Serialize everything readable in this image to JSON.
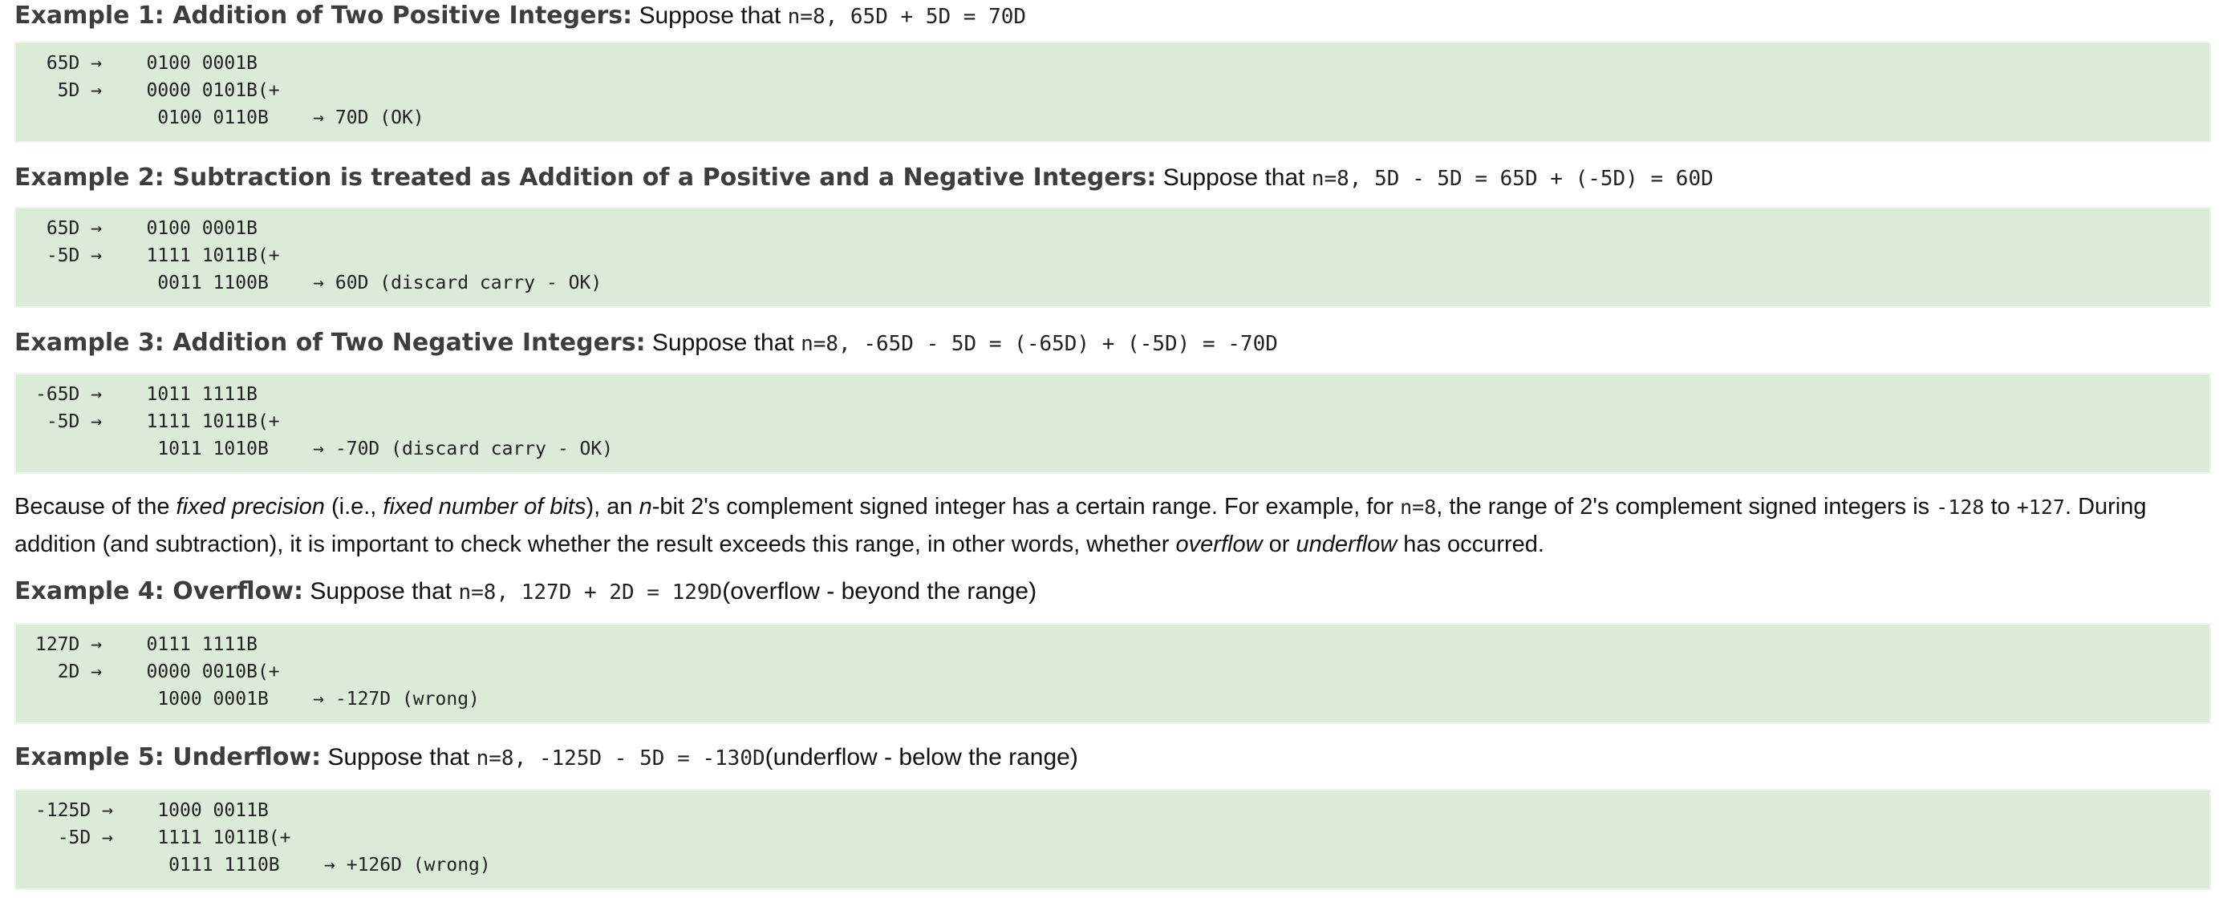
{
  "ex1": {
    "label": "Example 1: Addition of Two Positive Integers:",
    "lead": "Suppose that",
    "expr": "n=8, 65D + 5D = 70D",
    "code": " 65D →    0100 0001B\n  5D →    0000 0101B(+\n           0100 0110B    → 70D (OK)"
  },
  "ex2": {
    "label": "Example 2: Subtraction is treated as Addition of a Positive and a Negative Integers:",
    "lead": "Suppose that",
    "expr": "n=8, 5D - 5D = 65D + (-5D) = 60D",
    "code": " 65D →    0100 0001B\n -5D →    1111 1011B(+\n           0011 1100B    → 60D (discard carry - OK)"
  },
  "ex3": {
    "label": "Example 3: Addition of Two Negative Integers:",
    "lead": "Suppose that",
    "expr": "n=8, -65D - 5D = (-65D) + (-5D) = -70D",
    "code": "-65D →    1011 1111B\n -5D →    1111 1011B(+\n           1011 1010B    → -70D (discard carry - OK)"
  },
  "para": {
    "t1": "Because of the ",
    "i1": "fixed precision",
    "t2": " (i.e., ",
    "i2": "fixed number of bits",
    "t3": "), an ",
    "i3": "n",
    "t4": "-bit 2's complement signed integer has a certain range. For example, for ",
    "m1": "n=8",
    "t5": ", the range of 2's complement signed integers is ",
    "m2": "-128",
    "t6": " to ",
    "m3": "+127",
    "t7": ". During addition (and subtraction), it is important to check whether the result exceeds this range, in other words, whether ",
    "i4": "overflow",
    "t8": " or ",
    "i5": "underflow",
    "t9": " has occurred."
  },
  "ex4": {
    "label": "Example 4: Overflow:",
    "lead": "Suppose that",
    "expr": "n=8, 127D + 2D = 129D",
    "note": "(overflow - beyond the range)",
    "code": "127D →    0111 1111B\n  2D →    0000 0010B(+\n           1000 0001B    → -127D (wrong)"
  },
  "ex5": {
    "label": "Example 5: Underflow:",
    "lead": "Suppose that",
    "expr": "n=8, -125D - 5D = -130D",
    "note": "(underflow - below the range)",
    "code": "-125D →    1000 0011B\n  -5D →    1111 1011B(+\n            0111 1110B    → +126D (wrong)"
  }
}
